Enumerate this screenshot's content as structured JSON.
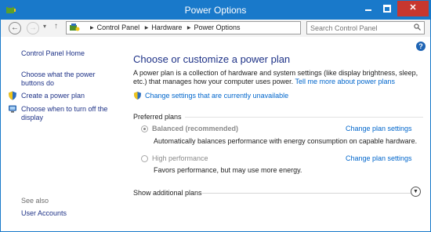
{
  "window": {
    "title": "Power Options",
    "minimize_glyph": "",
    "close_glyph": "✕"
  },
  "address_bar": {
    "breadcrumbs": [
      "Control Panel",
      "Hardware",
      "Power Options"
    ],
    "search_placeholder": "Search Control Panel"
  },
  "sidebar": {
    "items": [
      {
        "label": "Control Panel Home",
        "icon": ""
      },
      {
        "label": "Choose what the power buttons do",
        "icon": ""
      },
      {
        "label": "Create a power plan",
        "icon": "shield-icon"
      },
      {
        "label": "Choose when to turn off the display",
        "icon": "monitor-icon"
      }
    ],
    "see_also_label": "See also",
    "see_also_items": [
      {
        "label": "User Accounts"
      }
    ]
  },
  "main": {
    "help_glyph": "?",
    "heading": "Choose or customize a power plan",
    "description": "A power plan is a collection of hardware and system settings (like display brightness, sleep, etc.) that manages how your computer uses power.",
    "learn_more_link": "Tell me more about power plans",
    "change_unavailable_link": "Change settings that are currently unavailable",
    "preferred_plans_label": "Preferred plans",
    "plans": [
      {
        "name": "Balanced (recommended)",
        "selected": true,
        "description": "Automatically balances performance with energy consumption on capable hardware.",
        "change_link": "Change plan settings"
      },
      {
        "name": "High performance",
        "selected": false,
        "description": "Favors performance, but may use more energy.",
        "change_link": "Change plan settings"
      }
    ],
    "show_additional_label": "Show additional plans"
  },
  "colors": {
    "titlebar": "#1979ca",
    "close_button": "#c7372f",
    "link": "#0066cc",
    "heading": "#1e3287"
  }
}
